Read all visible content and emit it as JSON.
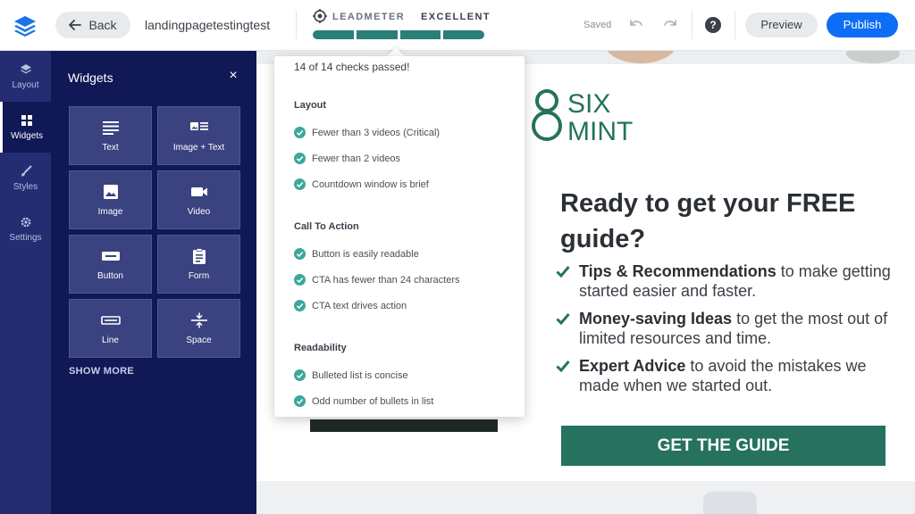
{
  "header": {
    "back_label": "Back",
    "page_name": "landingpagetestingtest",
    "leadmeter_label": "LEADMETER",
    "leadmeter_rating": "EXCELLENT",
    "leadmeter_score": 1.0,
    "saved_label": "Saved",
    "help_label": "?",
    "preview_label": "Preview",
    "publish_label": "Publish"
  },
  "rail": {
    "items": [
      {
        "label": "Layout",
        "icon": "layers-icon"
      },
      {
        "label": "Widgets",
        "icon": "grid-icon"
      },
      {
        "label": "Styles",
        "icon": "brush-icon"
      },
      {
        "label": "Settings",
        "icon": "gear-icon"
      }
    ]
  },
  "panel": {
    "title": "Widgets",
    "close_label": "×",
    "widgets": [
      {
        "label": "Text",
        "icon": "text-icon"
      },
      {
        "label": "Image + Text",
        "icon": "image-text-icon"
      },
      {
        "label": "Image",
        "icon": "image-icon"
      },
      {
        "label": "Video",
        "icon": "video-icon"
      },
      {
        "label": "Button",
        "icon": "button-icon"
      },
      {
        "label": "Form",
        "icon": "form-icon"
      },
      {
        "label": "Line",
        "icon": "line-icon"
      },
      {
        "label": "Space",
        "icon": "space-icon"
      }
    ],
    "show_more": "SHOW MORE"
  },
  "leadmeter_popover": {
    "summary": "14 of 14 checks passed!",
    "sections": [
      {
        "title": "Layout",
        "items": [
          "Fewer than 3 videos (Critical)",
          "Fewer than 2 videos",
          "Countdown window is brief"
        ]
      },
      {
        "title": "Call To Action",
        "items": [
          "Button is easily readable",
          "CTA has fewer than 24 characters",
          "CTA text drives action"
        ]
      },
      {
        "title": "Readability",
        "items": [
          "Bulleted list is concise",
          "Odd number of bullets in list"
        ]
      }
    ]
  },
  "landing_page": {
    "logo_line1": "SIX",
    "logo_line2": "MINT",
    "headline": "Ready to get your FREE guide?",
    "bullets": [
      {
        "bold": "Tips & Recommendations",
        "rest": " to make getting started easier and faster."
      },
      {
        "bold": "Money-saving Ideas",
        "rest": " to get the most out of limited resources and time."
      },
      {
        "bold": "Expert Advice",
        "rest": " to avoid the mistakes we made when we started out."
      }
    ],
    "cta_label": "GET THE GUIDE"
  },
  "colors": {
    "rail_bg": "#242d72",
    "panel_bg": "#101856",
    "publish_blue": "#0d6ef5",
    "leadmeter_teal": "#2a7f78",
    "brand_green": "#26725e"
  }
}
